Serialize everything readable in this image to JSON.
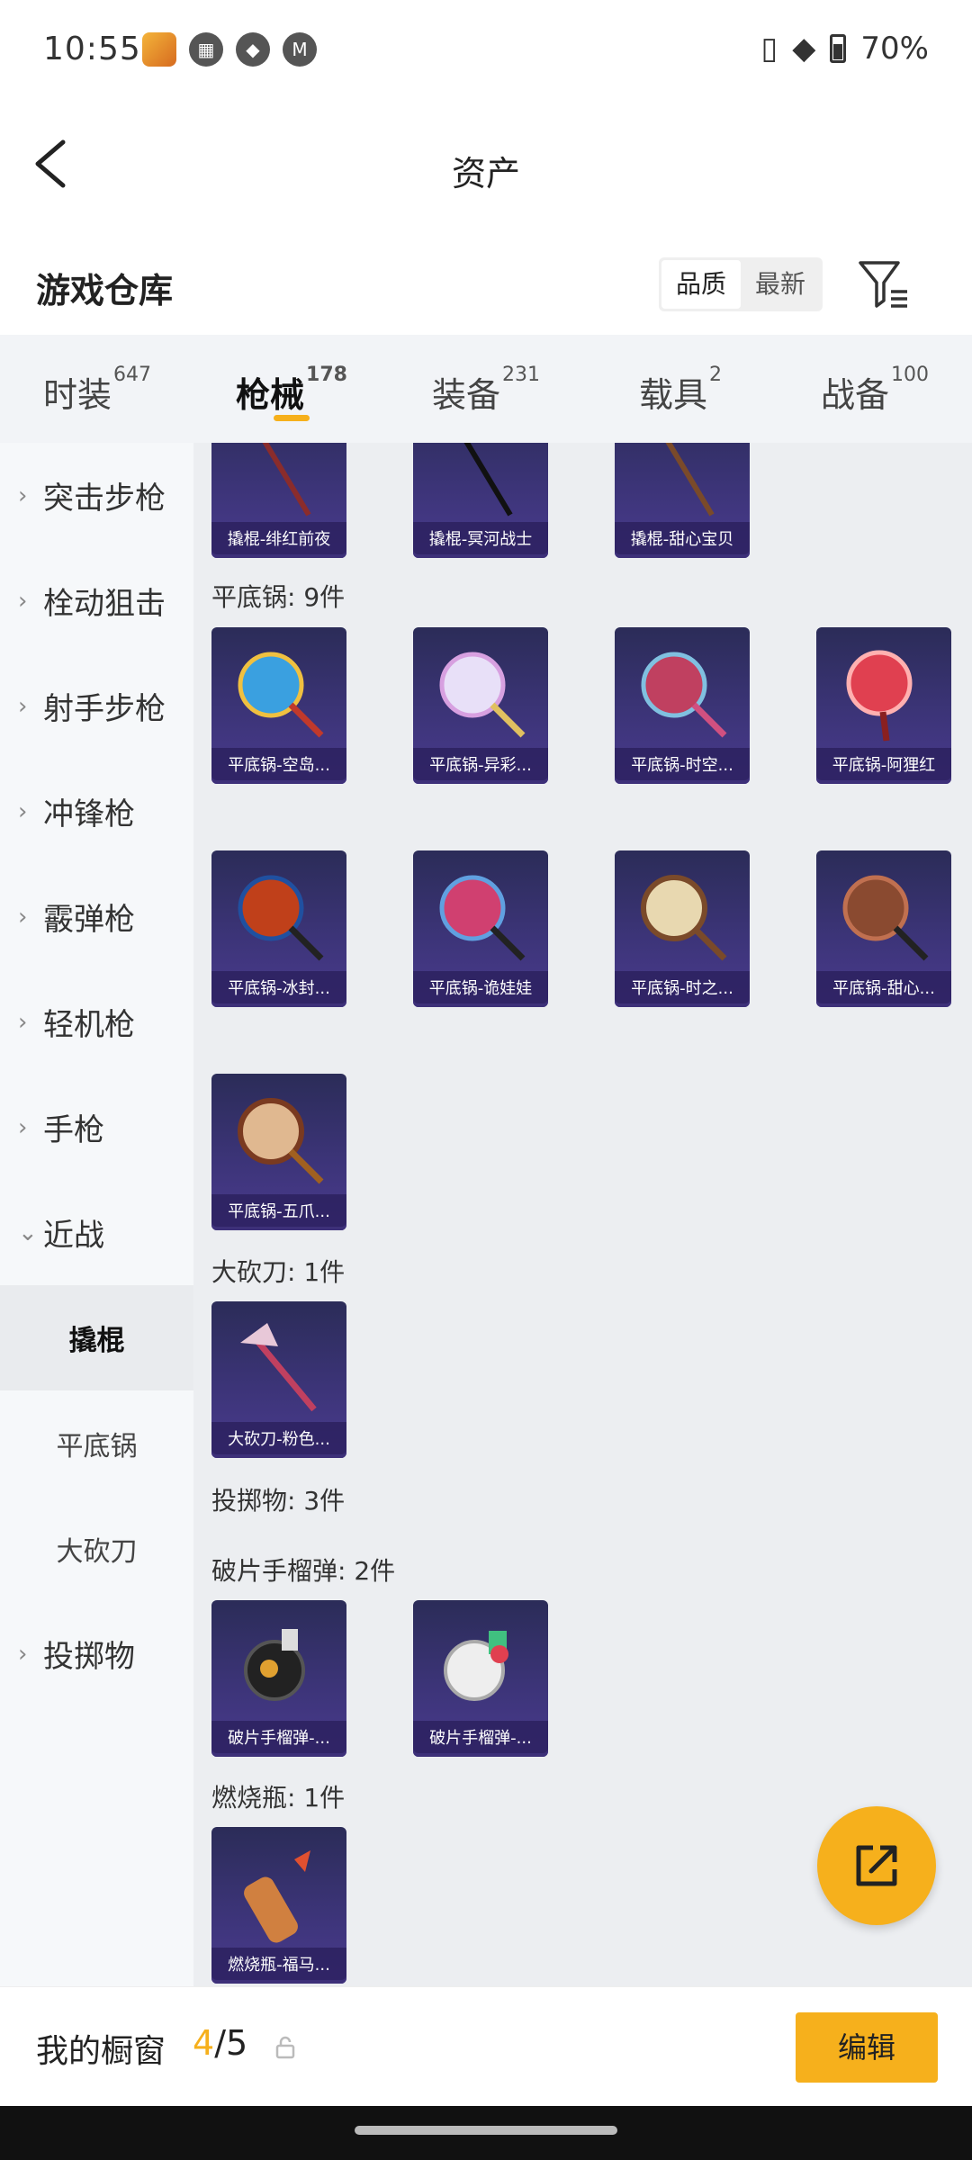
{
  "status": {
    "time": "10:55",
    "battery": "70%"
  },
  "header": {
    "title": "资产"
  },
  "section": {
    "title": "游戏仓库",
    "sort_options": [
      "品质",
      "最新"
    ]
  },
  "tabs": [
    {
      "label": "时装",
      "count": "647"
    },
    {
      "label": "枪械",
      "count": "178"
    },
    {
      "label": "装备",
      "count": "231"
    },
    {
      "label": "载具",
      "count": "2"
    },
    {
      "label": "战备",
      "count": "100"
    }
  ],
  "sidebar": {
    "items": [
      "突击步枪",
      "栓动狙击",
      "射手步枪",
      "冲锋枪",
      "霰弹枪",
      "轻机枪",
      "手枪",
      "近战"
    ],
    "subitems": [
      "撬棍",
      "平底锅",
      "大砍刀"
    ],
    "last_item": "投掷物"
  },
  "content": {
    "crowbar_items": [
      "撬棍-绯红前夜",
      "撬棍-冥河战士",
      "撬棍-甜心宝贝"
    ],
    "pan_label": "平底锅: 9件",
    "pan_items": [
      "平底锅-空岛...",
      "平底锅-异彩...",
      "平底锅-时空...",
      "平底锅-阿狸红",
      "平底锅-冰封...",
      "平底锅-诡娃娃",
      "平底锅-时之...",
      "平底锅-甜心...",
      "平底锅-五爪..."
    ],
    "machete_label": "大砍刀: 1件",
    "machete_items": [
      "大砍刀-粉色..."
    ],
    "throwable_label": "投掷物: 3件",
    "frag_label": "破片手榴弹: 2件",
    "frag_items": [
      "破片手榴弹-...",
      "破片手榴弹-..."
    ],
    "molotov_label": "燃烧瓶: 1件",
    "molotov_items": [
      "燃烧瓶-福马..."
    ]
  },
  "bottom": {
    "label": "我的橱窗",
    "count_current": "4",
    "count_total": "/5",
    "edit_label": "编辑"
  },
  "colors": {
    "accent": "#f6b01c",
    "card": "#3c3478"
  }
}
